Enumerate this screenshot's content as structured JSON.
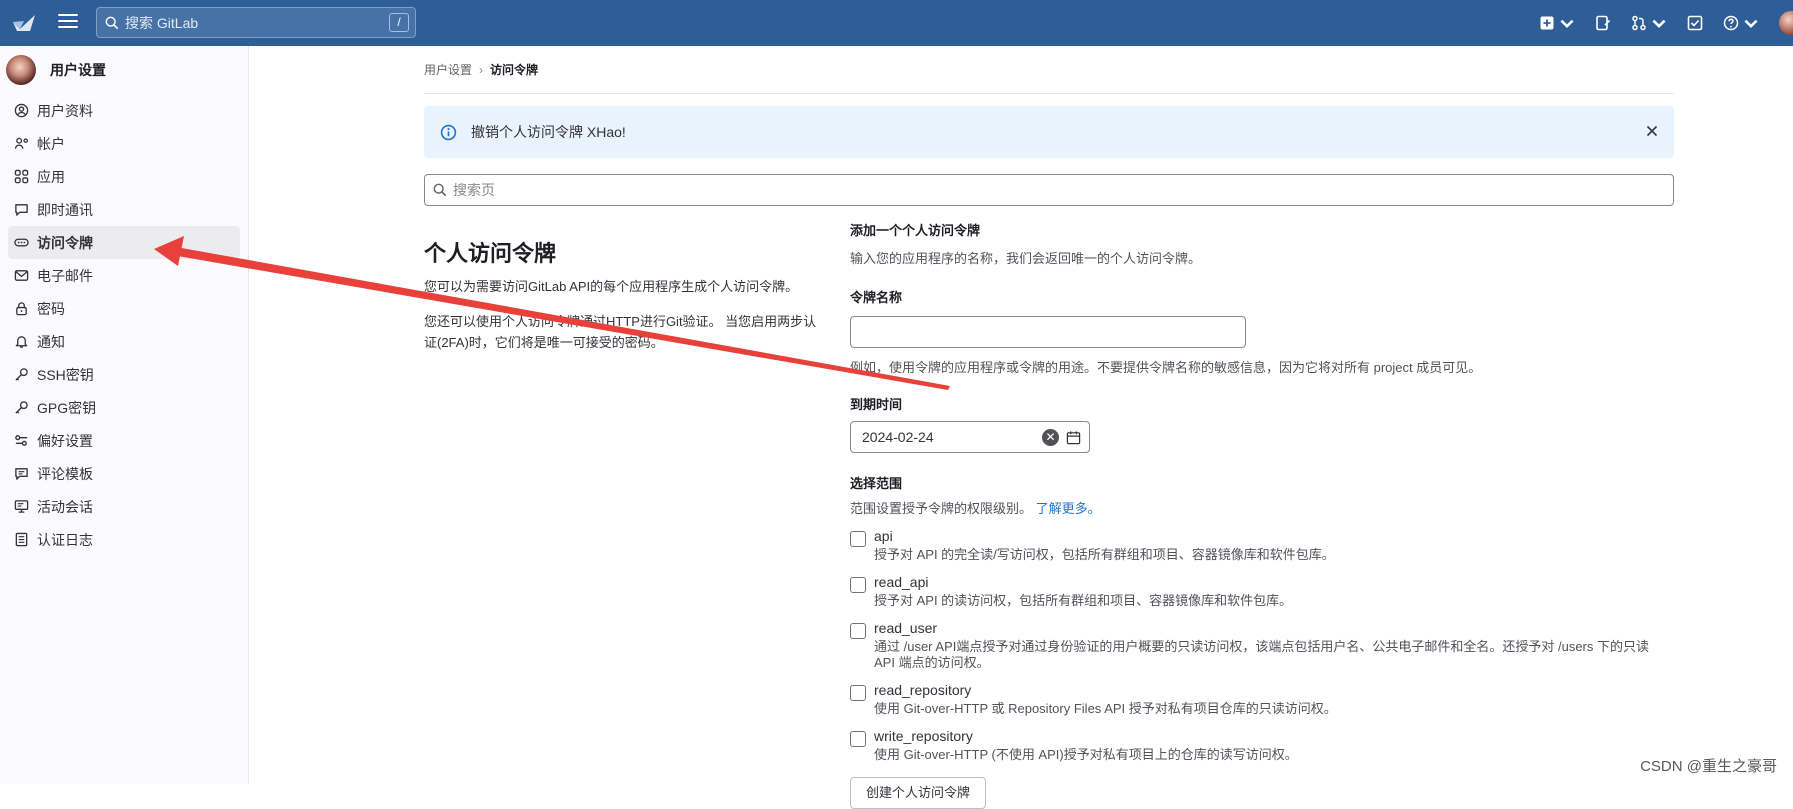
{
  "topbar": {
    "search_placeholder": "搜索 GitLab",
    "search_shortcut": "/",
    "brand_color": "#2f5d97"
  },
  "sidebar": {
    "title": "用户设置",
    "items": [
      {
        "label": "用户资料",
        "icon": "profile-icon"
      },
      {
        "label": "帐户",
        "icon": "account-icon"
      },
      {
        "label": "应用",
        "icon": "applications-icon"
      },
      {
        "label": "即时通讯",
        "icon": "chat-icon"
      },
      {
        "label": "访问令牌",
        "icon": "token-icon",
        "active": true
      },
      {
        "label": "电子邮件",
        "icon": "mail-icon"
      },
      {
        "label": "密码",
        "icon": "lock-icon"
      },
      {
        "label": "通知",
        "icon": "notifications-icon"
      },
      {
        "label": "SSH密钥",
        "icon": "key-icon"
      },
      {
        "label": "GPG密钥",
        "icon": "key-icon"
      },
      {
        "label": "偏好设置",
        "icon": "preferences-icon"
      },
      {
        "label": "评论模板",
        "icon": "comment-icon"
      },
      {
        "label": "活动会话",
        "icon": "monitor-icon"
      },
      {
        "label": "认证日志",
        "icon": "log-icon"
      }
    ]
  },
  "breadcrumb": {
    "parent": "用户设置",
    "current": "访问令牌"
  },
  "alert": {
    "text": "撤销个人访问令牌 XHao!"
  },
  "page_search": {
    "placeholder": "搜索页"
  },
  "intro": {
    "heading": "个人访问令牌",
    "p1": "您可以为需要访问GitLab API的每个应用程序生成个人访问令牌。",
    "p2": "您还可以使用个人访问令牌通过HTTP进行Git验证。 当您启用两步认证(2FA)时，它们将是唯一可接受的密码。"
  },
  "form": {
    "section_title": "添加一个个人访问令牌",
    "section_help": "输入您的应用程序的名称，我们会返回唯一的个人访问令牌。",
    "name_label": "令牌名称",
    "name_value": "",
    "name_help": "例如，使用令牌的应用程序或令牌的用途。不要提供令牌名称的敏感信息，因为它将对所有 project 成员可见。",
    "expiry_label": "到期时间",
    "expiry_value": "2024-02-24",
    "scope_label": "选择范围",
    "scope_help": "范围设置授予令牌的权限级别。",
    "scope_learn_more": "了解更多。",
    "scopes": [
      {
        "name": "api",
        "desc": "授予对 API 的完全读/写访问权，包括所有群组和项目、容器镜像库和软件包库。",
        "checked": false
      },
      {
        "name": "read_api",
        "desc": "授予对 API 的读访问权，包括所有群组和项目、容器镜像库和软件包库。",
        "checked": false
      },
      {
        "name": "read_user",
        "desc": "通过 /user API端点授予对通过身份验证的用户概要的只读访问权，该端点包括用户名、公共电子邮件和全名。还授予对 /users 下的只读 API 端点的访问权。",
        "checked": false
      },
      {
        "name": "read_repository",
        "desc": "使用 Git-over-HTTP 或 Repository Files API 授予对私有项目仓库的只读访问权。",
        "checked": false
      },
      {
        "name": "write_repository",
        "desc": "使用 Git-over-HTTP (不使用 API)授予对私有项目上的仓库的读写访问权。",
        "checked": false
      }
    ],
    "create_label": "创建个人访问令牌"
  },
  "watermark": "CSDN @重生之豪哥",
  "annotation_color": "#e8403a"
}
